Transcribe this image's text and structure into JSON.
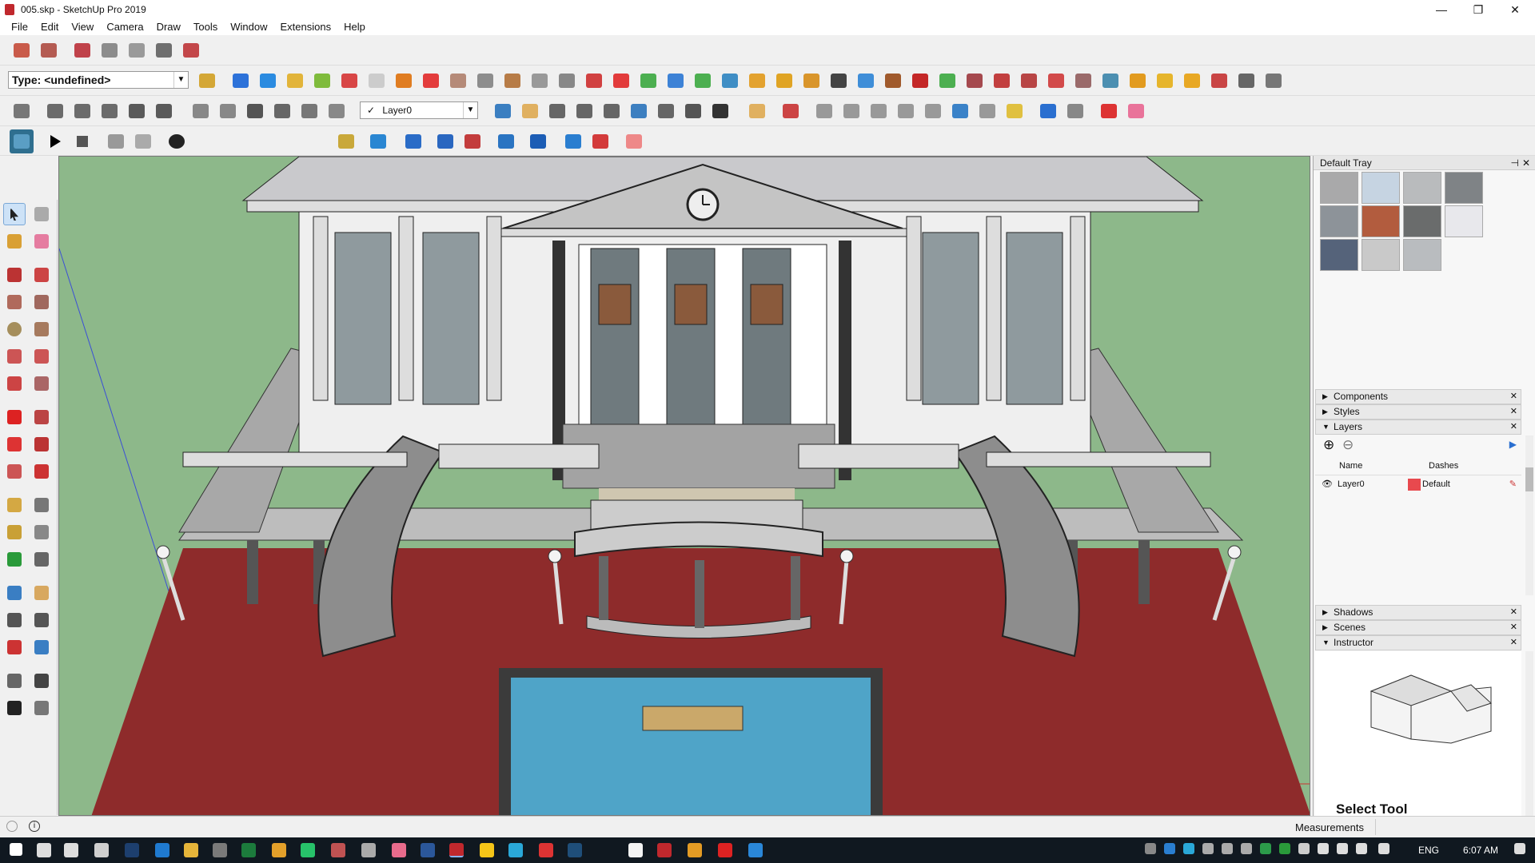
{
  "window": {
    "title": "005.skp - SketchUp Pro 2019",
    "controls": {
      "minimize": "—",
      "restore": "❐",
      "close": "✕"
    }
  },
  "menu": [
    "File",
    "Edit",
    "View",
    "Camera",
    "Draw",
    "Tools",
    "Window",
    "Extensions",
    "Help"
  ],
  "toolbar": {
    "type_value": "Type: <undefined>",
    "layer_value": "Layer0",
    "layer_check": "✓"
  },
  "tray": {
    "title": "Default Tray",
    "pin": "⊣",
    "close": "✕",
    "panels": {
      "components": "Components",
      "styles": "Styles",
      "layers": "Layers",
      "shadows": "Shadows",
      "scenes": "Scenes",
      "instructor": "Instructor"
    },
    "layers": {
      "add": "⊕",
      "remove": "⊖",
      "col_name": "Name",
      "col_dashes": "Dashes",
      "row_name": "Layer0",
      "row_dashes": "Default",
      "row_color": "#e8494e"
    },
    "instructor_title": "Select Tool"
  },
  "swatch_colors": [
    "#a9a9aa",
    "#c6d4e2",
    "#b9bbbd",
    "#7f8386",
    "#8d9399",
    "#b25c3e",
    "#6a6c6c",
    "#e8e8ec",
    "#55637a",
    "#c9c9c9",
    "#b9bcbf"
  ],
  "status": {
    "measurements_label": "Measurements"
  },
  "taskbar": {
    "language": "ENG",
    "time": "6:07 AM"
  },
  "model": {
    "clock_label": "clock"
  }
}
